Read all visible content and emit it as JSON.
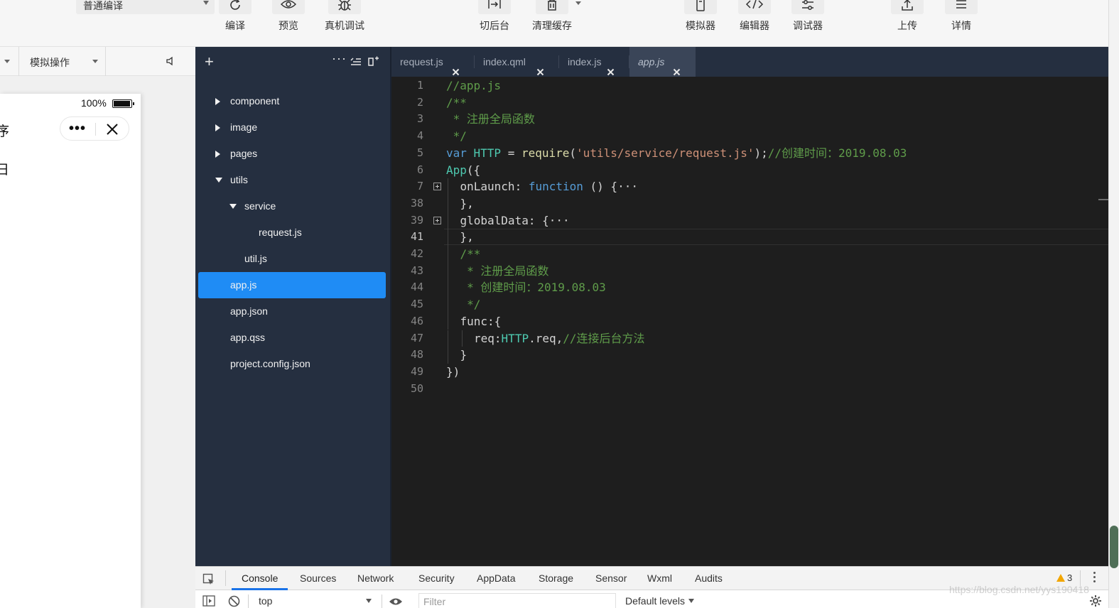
{
  "toolbar": {
    "mode_select": "普通编译",
    "buttons": [
      {
        "label": "编译",
        "icon": "refresh-icon"
      },
      {
        "label": "预览",
        "icon": "eye-icon"
      },
      {
        "label": "真机调试",
        "icon": "bug-icon"
      },
      {
        "label": "切后台",
        "icon": "switch-background-icon"
      },
      {
        "label": "清理缓存",
        "icon": "trash-icon"
      },
      {
        "label": "模拟器",
        "icon": "phone-icon"
      },
      {
        "label": "编辑器",
        "icon": "code-icon"
      },
      {
        "label": "调试器",
        "icon": "sliders-icon"
      },
      {
        "label": "上传",
        "icon": "upload-icon"
      },
      {
        "label": "详情",
        "icon": "menu-icon"
      }
    ]
  },
  "simulator": {
    "operation_select": "模拟操作",
    "battery_percent": "100%",
    "partial_text_1": "序",
    "partial_text_2": "日"
  },
  "file_tree": [
    {
      "label": "component",
      "type": "folder",
      "state": "collapsed",
      "depth": 0
    },
    {
      "label": "image",
      "type": "folder",
      "state": "collapsed",
      "depth": 0
    },
    {
      "label": "pages",
      "type": "folder",
      "state": "collapsed",
      "depth": 0
    },
    {
      "label": "utils",
      "type": "folder",
      "state": "expanded",
      "depth": 0
    },
    {
      "label": "service",
      "type": "folder",
      "state": "expanded",
      "depth": 1
    },
    {
      "label": "request.js",
      "type": "file",
      "depth": 2
    },
    {
      "label": "util.js",
      "type": "file",
      "depth": 1
    },
    {
      "label": "app.js",
      "type": "file",
      "depth": 0,
      "selected": true
    },
    {
      "label": "app.json",
      "type": "file",
      "depth": 0
    },
    {
      "label": "app.qss",
      "type": "file",
      "depth": 0
    },
    {
      "label": "project.config.json",
      "type": "file",
      "depth": 0
    }
  ],
  "editor": {
    "tabs": [
      {
        "label": "request.js",
        "active": false
      },
      {
        "label": "index.qml",
        "active": false
      },
      {
        "label": "index.js",
        "active": false
      },
      {
        "label": "app.js",
        "active": true
      }
    ],
    "current_line": "41",
    "lines": [
      {
        "num": "1",
        "indent": 0,
        "tokens": [
          {
            "t": "//app.js",
            "c": "cm"
          }
        ]
      },
      {
        "num": "2",
        "indent": 0,
        "tokens": [
          {
            "t": "/**",
            "c": "cm"
          }
        ]
      },
      {
        "num": "3",
        "indent": 0,
        "tokens": [
          {
            "t": " * 注册全局函数",
            "c": "cm"
          }
        ]
      },
      {
        "num": "4",
        "indent": 0,
        "tokens": [
          {
            "t": " */",
            "c": "cm"
          }
        ]
      },
      {
        "num": "5",
        "indent": 0,
        "tokens": [
          {
            "t": "var ",
            "c": "kw"
          },
          {
            "t": "HTTP",
            "c": "id"
          },
          {
            "t": " = ",
            "c": "prop"
          },
          {
            "t": "require",
            "c": "fn"
          },
          {
            "t": "(",
            "c": "prop"
          },
          {
            "t": "'utils/service/request.js'",
            "c": "str"
          },
          {
            "t": ");",
            "c": "prop"
          },
          {
            "t": "//创建时间：2019.08.03",
            "c": "cm"
          }
        ]
      },
      {
        "num": "6",
        "indent": 0,
        "tokens": [
          {
            "t": "App",
            "c": "id"
          },
          {
            "t": "({",
            "c": "prop"
          }
        ]
      },
      {
        "num": "7",
        "indent": 1,
        "fold": true,
        "tokens": [
          {
            "t": "onLaunch",
            "c": "prop"
          },
          {
            "t": ": ",
            "c": "prop"
          },
          {
            "t": "function",
            "c": "kw"
          },
          {
            "t": " () {",
            "c": "prop"
          },
          {
            "t": "···",
            "c": "prop"
          }
        ]
      },
      {
        "num": "38",
        "indent": 1,
        "tokens": [
          {
            "t": "},",
            "c": "prop"
          }
        ]
      },
      {
        "num": "39",
        "indent": 1,
        "fold": true,
        "tokens": [
          {
            "t": "globalData",
            "c": "prop"
          },
          {
            "t": ": {",
            "c": "prop"
          },
          {
            "t": "···",
            "c": "prop"
          }
        ]
      },
      {
        "num": "41",
        "indent": 1,
        "current": true,
        "tokens": [
          {
            "t": "},",
            "c": "prop"
          }
        ]
      },
      {
        "num": "42",
        "indent": 1,
        "tokens": [
          {
            "t": "/**",
            "c": "cm"
          }
        ]
      },
      {
        "num": "43",
        "indent": 1,
        "tokens": [
          {
            "t": " * 注册全局函数",
            "c": "cm"
          }
        ]
      },
      {
        "num": "44",
        "indent": 1,
        "tokens": [
          {
            "t": " * 创建时间：2019.08.03",
            "c": "cm"
          }
        ]
      },
      {
        "num": "45",
        "indent": 1,
        "tokens": [
          {
            "t": " */",
            "c": "cm"
          }
        ]
      },
      {
        "num": "46",
        "indent": 1,
        "tokens": [
          {
            "t": "func",
            "c": "prop"
          },
          {
            "t": ":{",
            "c": "prop"
          }
        ]
      },
      {
        "num": "47",
        "indent": 2,
        "tokens": [
          {
            "t": "req",
            "c": "prop"
          },
          {
            "t": ":",
            "c": "prop"
          },
          {
            "t": "HTTP",
            "c": "id"
          },
          {
            "t": ".req,",
            "c": "prop"
          },
          {
            "t": "//连接后台方法",
            "c": "cm"
          }
        ]
      },
      {
        "num": "48",
        "indent": 1,
        "tokens": [
          {
            "t": "}",
            "c": "prop"
          }
        ]
      },
      {
        "num": "49",
        "indent": 0,
        "tokens": [
          {
            "t": "})",
            "c": "prop"
          }
        ]
      },
      {
        "num": "50",
        "indent": 0,
        "tokens": []
      }
    ]
  },
  "devtools": {
    "tabs": [
      {
        "label": "Console",
        "active": true
      },
      {
        "label": "Sources"
      },
      {
        "label": "Network"
      },
      {
        "label": "Security"
      },
      {
        "label": "AppData"
      },
      {
        "label": "Storage"
      },
      {
        "label": "Sensor"
      },
      {
        "label": "Wxml"
      },
      {
        "label": "Audits"
      }
    ],
    "warning_count": "3",
    "context": "top",
    "filter_placeholder": "Filter",
    "levels": "Default levels"
  },
  "watermark": "https://blog.csdn.net/yys190418"
}
